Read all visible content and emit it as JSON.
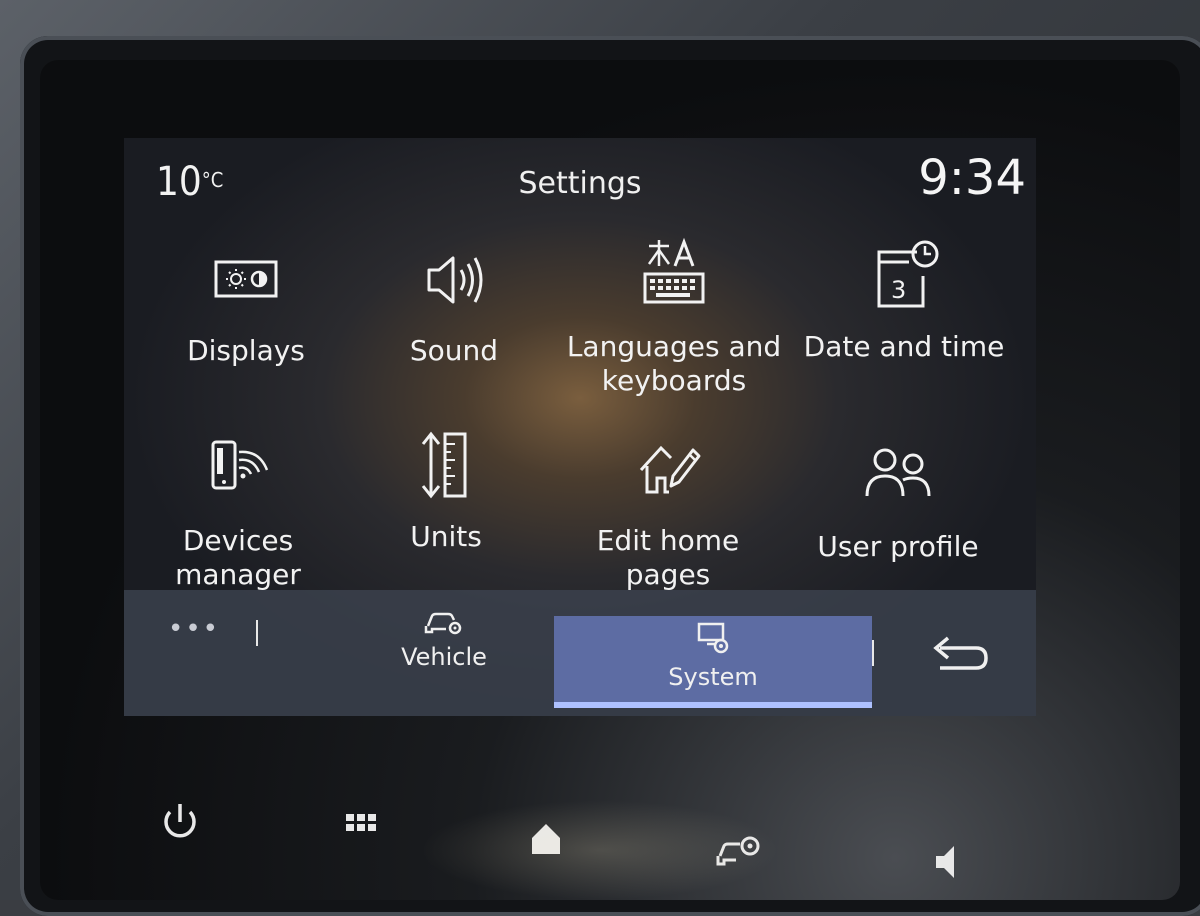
{
  "status": {
    "temperature": "10",
    "temperature_unit": "°C",
    "title": "Settings",
    "clock": "9:34"
  },
  "settings": {
    "items": [
      {
        "label_line1": "Displays",
        "label_line2": "",
        "icon": "display-brightness-icon"
      },
      {
        "label_line1": "Sound",
        "label_line2": "",
        "icon": "speaker-icon"
      },
      {
        "label_line1": "Languages and",
        "label_line2": "keyboards",
        "icon": "language-keyboard-icon"
      },
      {
        "label_line1": "Date and time",
        "label_line2": "",
        "icon": "calendar-clock-icon"
      },
      {
        "label_line1": "Devices",
        "label_line2": "manager",
        "icon": "phone-wifi-icon"
      },
      {
        "label_line1": "Units",
        "label_line2": "",
        "icon": "ruler-arrows-icon"
      },
      {
        "label_line1": "Edit home",
        "label_line2": "pages",
        "icon": "home-edit-icon"
      },
      {
        "label_line1": "User profile",
        "label_line2": "",
        "icon": "users-icon"
      }
    ]
  },
  "tabs": {
    "more": "•••",
    "vehicle": "Vehicle",
    "system": "System",
    "active": "System"
  },
  "colors": {
    "active_tab": "#5d6ca3",
    "active_underline": "#aec1ff",
    "text": "#f2f2f2"
  },
  "dock": {
    "icons": [
      "power-icon",
      "apps-grid-icon",
      "home-icon",
      "vehicle-settings-icon",
      "volume-icon"
    ]
  }
}
